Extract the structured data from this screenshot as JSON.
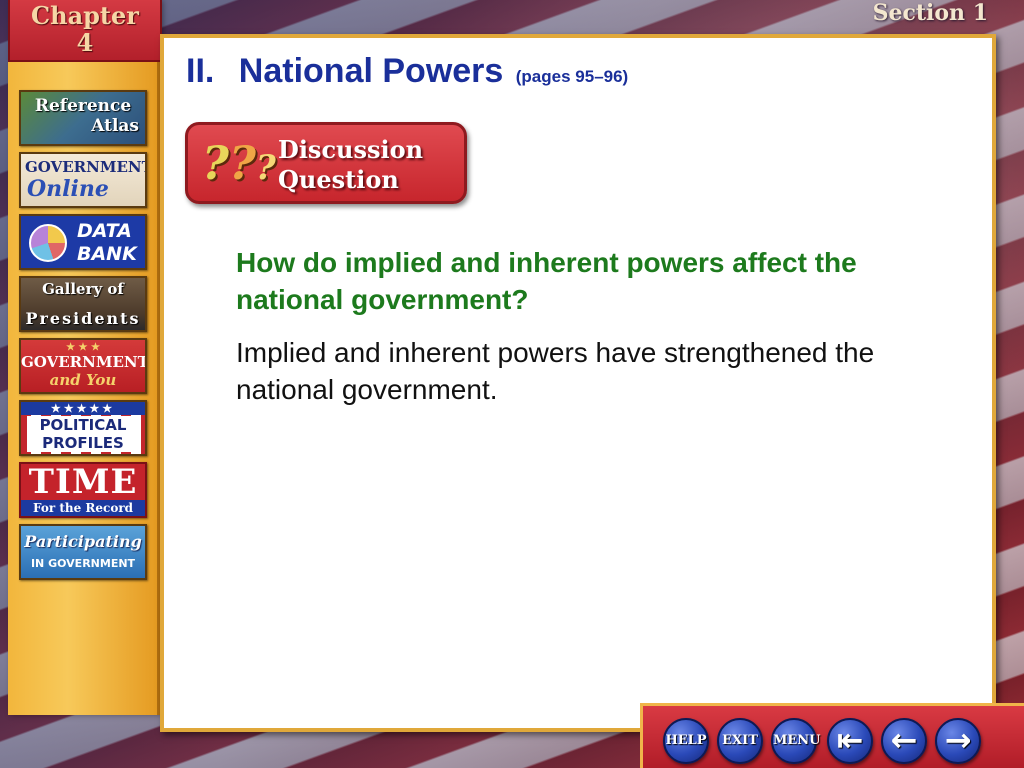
{
  "header": {
    "chapter_word": "Chapter",
    "chapter_number": "4",
    "section": "Section 1"
  },
  "sidebar": {
    "items": [
      {
        "line1": "Reference",
        "line2": "Atlas"
      },
      {
        "line1": "GOVERNMENT",
        "line2": "Online"
      },
      {
        "line1": "DATA",
        "line2": "BANK"
      },
      {
        "line1": "Gallery of",
        "line2": "Presidents"
      },
      {
        "line1": "GOVERNMENT",
        "line2": "and You"
      },
      {
        "line1": "POLITICAL",
        "line2": "PROFILES"
      },
      {
        "line1": "TIME",
        "line2": "For the Record"
      },
      {
        "line1": "Participating",
        "line2": "IN GOVERNMENT"
      }
    ]
  },
  "slide": {
    "roman": "II.",
    "title": "National Powers",
    "pages": "(pages 95–96)",
    "badge": {
      "line1": "Discussion",
      "line2": "Question"
    },
    "question": "How do implied and inherent powers affect the national government?",
    "answer": "Implied and inherent powers have strengthened the national government."
  },
  "nav": {
    "help": "HELP",
    "exit": "EXIT",
    "menu": "MENU",
    "first": "⇤",
    "back": "←",
    "next": "→"
  },
  "colors": {
    "title": "#1a2f9a",
    "question": "#1d7a1d",
    "accent_red": "#c7262d",
    "gold": "#e0a83a"
  }
}
